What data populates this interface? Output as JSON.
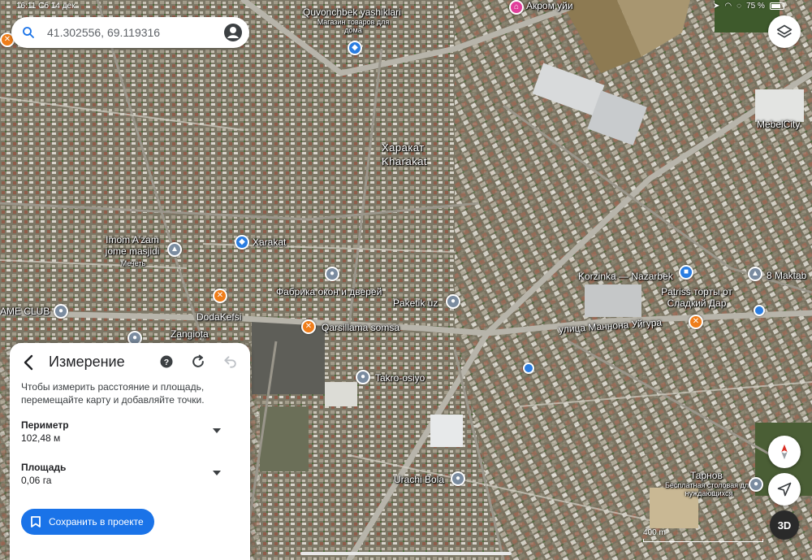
{
  "status": {
    "time": "16:11",
    "date": "Сб 14 дек.",
    "battery": "75 %"
  },
  "search": {
    "query": "41.302556, 69.119316"
  },
  "map_labels": {
    "quvonchbek": "Quvonchbek yashiklari",
    "quvonchbek_sub": "Магазин товаров для дома",
    "akrom": "Акром уйи",
    "mebelcity": "MebelCity",
    "kharakat_ru": "Харакат",
    "kharakat_lat": "Kharakat",
    "xarakat": "Xarakat",
    "imom": "Imom A'zam jome masjidi",
    "imom_sub": "Мечеть",
    "fabrika": "Фабрика окон и дверей",
    "paketik": "Paketik uz",
    "korzinka": "Korzinka — Nazarbek",
    "patriss": "Patriss торты от Сладкий Дар",
    "maktab": "8 Maktab",
    "game_club": "AME CLUB",
    "dodakefsi": "DodaKefsi",
    "zangiota": "Zangiota",
    "qarsillama": "Qarsillama somsa",
    "mannona": "улица Маннона Уйгура",
    "takro": "Takro-osiyo",
    "urachi": "Urachi Bola",
    "tarnov": "Тарнов",
    "tarnov_sub": "Бесплатная столовая для нуждающихся"
  },
  "panel": {
    "title": "Измерение",
    "hint": "Чтобы измерить расстояние и площадь, перемещайте карту и добавляйте точки.",
    "perimeter_label": "Периметр",
    "perimeter_value": "102,48 м",
    "area_label": "Площадь",
    "area_value": "0,06 га",
    "save_label": "Сохранить в проекте"
  },
  "controls": {
    "view_3d": "3D"
  },
  "scale": {
    "label": "400 m"
  },
  "icons": [
    "search-icon",
    "account-icon",
    "layers-icon",
    "compass-icon",
    "my-location-icon",
    "back-arrow-icon",
    "help-icon",
    "redo-icon",
    "undo-icon",
    "bookmark-icon",
    "chevron-down-icon"
  ],
  "colors": {
    "accent": "#1a73e8",
    "poi_blue": "#2a7de1",
    "poi_orange": "#ef7d1a",
    "poi_gray": "#7b8ca0",
    "poi_pink": "#e03e9a"
  }
}
